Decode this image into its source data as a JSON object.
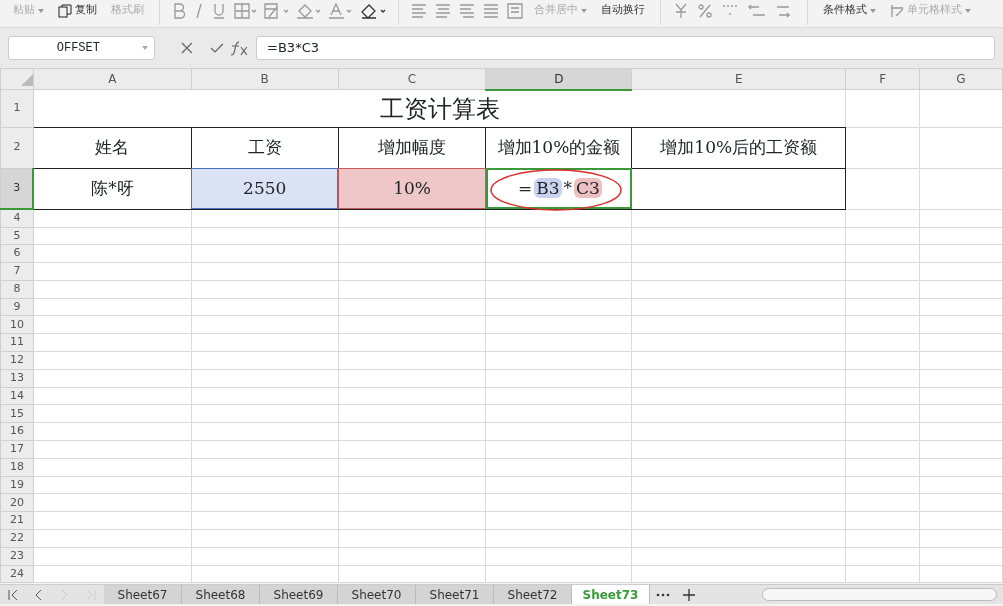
{
  "toolbar": {
    "items": [
      {
        "kind": "text",
        "label": "粘贴",
        "disabled": true,
        "dropdown": true
      },
      {
        "kind": "copy",
        "label": "复制",
        "disabled": false,
        "dropdown": false
      },
      {
        "kind": "text",
        "label": "格式刷",
        "disabled": true,
        "dropdown": false
      },
      {
        "kind": "font-group"
      },
      {
        "kind": "align-group"
      },
      {
        "kind": "text",
        "label": "合并居中",
        "disabled": true,
        "dropdown": true
      },
      {
        "kind": "text",
        "label": "自动换行",
        "disabled": false,
        "dropdown": false
      },
      {
        "kind": "number-group"
      },
      {
        "kind": "text",
        "label": "条件格式",
        "disabled": false,
        "dropdown": true
      },
      {
        "kind": "style",
        "label": "单元格样式",
        "disabled": true,
        "dropdown": true
      }
    ]
  },
  "formula_bar": {
    "name_box": "OFFSET",
    "formula": "=B3*C3"
  },
  "columns": [
    {
      "label": "A",
      "selected": false
    },
    {
      "label": "B",
      "selected": false
    },
    {
      "label": "C",
      "selected": false
    },
    {
      "label": "D",
      "selected": true
    },
    {
      "label": "E",
      "selected": false
    },
    {
      "label": "F",
      "selected": false
    },
    {
      "label": "G",
      "selected": false
    }
  ],
  "rows": [
    {
      "label": "1",
      "selected": false,
      "kind": "title",
      "cells": [
        {
          "text": "工资计算表"
        }
      ]
    },
    {
      "label": "2",
      "selected": false,
      "kind": "header",
      "cells": [
        {
          "text": "姓名"
        },
        {
          "text": "工资"
        },
        {
          "text": "增加幅度"
        },
        {
          "text": "增加10%的金额"
        },
        {
          "text": "增加10%后的工资额"
        }
      ]
    },
    {
      "label": "3",
      "selected": true,
      "kind": "data",
      "cells": [
        {
          "text": "陈*呀"
        },
        {
          "text": "2550",
          "color": "#dbe2f4"
        },
        {
          "text": "10%",
          "color": "#efc7c8"
        },
        {
          "editing": true,
          "tokens": [
            {
              "text": "="
            },
            {
              "text": "B3",
              "color": "#c9d3f0"
            },
            {
              "text": "*"
            },
            {
              "text": "C3",
              "color": "#ecc0c2"
            }
          ]
        }
      ]
    },
    {
      "label": "4",
      "selected": false,
      "kind": "empty"
    },
    {
      "label": "5",
      "selected": false,
      "kind": "empty"
    },
    {
      "label": "6",
      "selected": false,
      "kind": "empty"
    },
    {
      "label": "7",
      "selected": false,
      "kind": "empty"
    },
    {
      "label": "8",
      "selected": false,
      "kind": "empty"
    },
    {
      "label": "9",
      "selected": false,
      "kind": "empty"
    },
    {
      "label": "10",
      "selected": false,
      "kind": "empty"
    },
    {
      "label": "11",
      "selected": false,
      "kind": "empty"
    },
    {
      "label": "12",
      "selected": false,
      "kind": "empty"
    },
    {
      "label": "13",
      "selected": false,
      "kind": "empty"
    },
    {
      "label": "14",
      "selected": false,
      "kind": "empty"
    },
    {
      "label": "15",
      "selected": false,
      "kind": "empty"
    },
    {
      "label": "16",
      "selected": false,
      "kind": "empty"
    },
    {
      "label": "17",
      "selected": false,
      "kind": "empty"
    },
    {
      "label": "18",
      "selected": false,
      "kind": "empty"
    },
    {
      "label": "19",
      "selected": false,
      "kind": "empty"
    },
    {
      "label": "20",
      "selected": false,
      "kind": "empty"
    },
    {
      "label": "21",
      "selected": false,
      "kind": "empty"
    },
    {
      "label": "22",
      "selected": false,
      "kind": "empty"
    },
    {
      "label": "23",
      "selected": false,
      "kind": "empty"
    },
    {
      "label": "24",
      "selected": false,
      "kind": "empty"
    }
  ],
  "sheet_tabs": [
    {
      "label": "Sheet67",
      "selected": false
    },
    {
      "label": "Sheet68",
      "selected": false
    },
    {
      "label": "Sheet69",
      "selected": false
    },
    {
      "label": "Sheet70",
      "selected": false
    },
    {
      "label": "Sheet71",
      "selected": false
    },
    {
      "label": "Sheet72",
      "selected": false
    },
    {
      "label": "Sheet73",
      "selected": true
    }
  ]
}
